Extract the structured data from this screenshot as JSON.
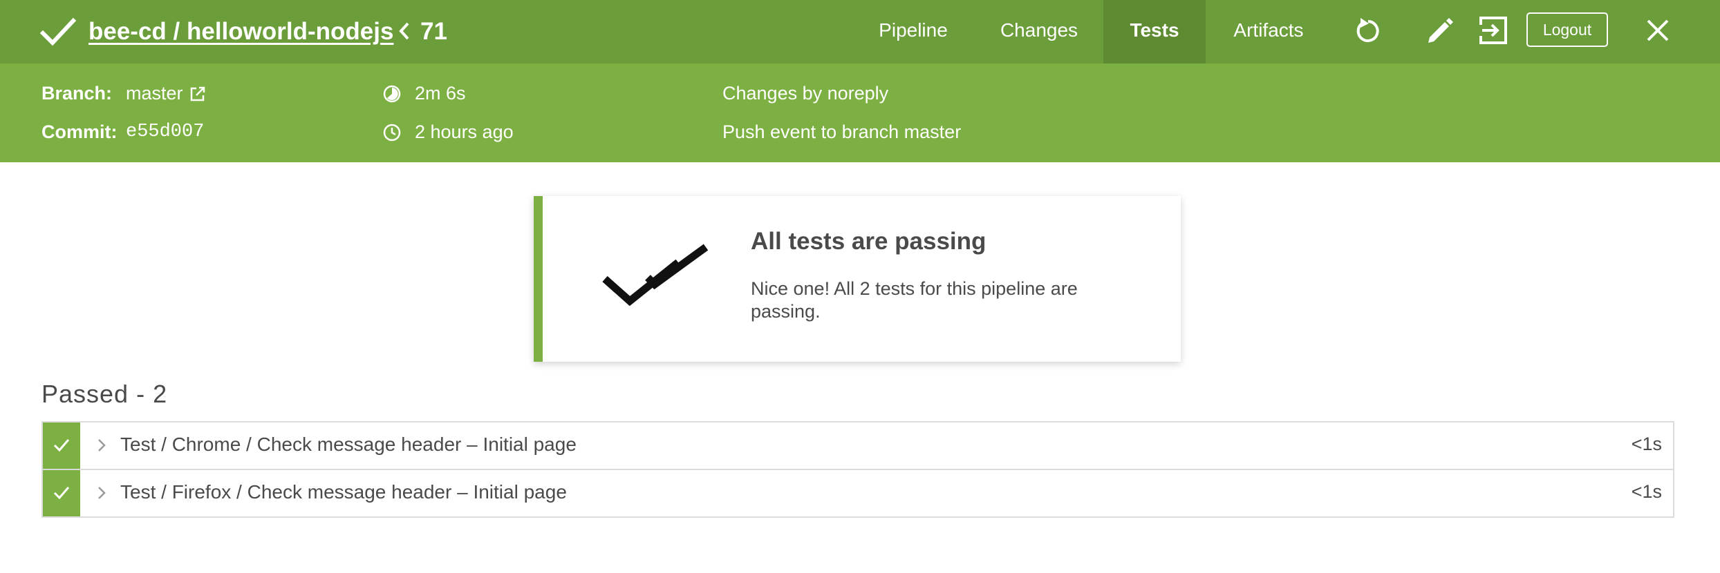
{
  "header": {
    "title": "bee-cd / helloworld-nodejs",
    "run_number": "71",
    "tabs": [
      {
        "label": "Pipeline"
      },
      {
        "label": "Changes"
      },
      {
        "label": "Tests"
      },
      {
        "label": "Artifacts"
      }
    ],
    "active_tab": "Tests",
    "logout_label": "Logout",
    "icons": [
      "check-icon",
      "chevron-left-icon",
      "replay-icon",
      "pencil-icon",
      "exit-icon",
      "close-icon"
    ]
  },
  "run_info": {
    "branch_label": "Branch:",
    "branch_value": "master",
    "commit_label": "Commit:",
    "commit_value": "e55d007",
    "duration": "2m 6s",
    "started": "2 hours ago",
    "changes_by": "Changes by noreply",
    "cause": "Push event to branch master"
  },
  "summary": {
    "title": "All tests are passing",
    "message": "Nice one! All 2 tests for this pipeline are passing.",
    "icon": "double-check-icon"
  },
  "passed_section": {
    "heading": "Passed - 2",
    "tests": [
      {
        "name": "Test / Chrome / Check message header – Initial page",
        "duration": "<1s",
        "status": "passed"
      },
      {
        "name": "Test / Firefox / Check message header – Initial page",
        "duration": "<1s",
        "status": "passed"
      }
    ]
  },
  "colors": {
    "header_bg": "#6b9e3a",
    "active_tab_bg": "#5e8b32",
    "info_bg": "#7db042",
    "success": "#7db042",
    "text": "#4a4a4a"
  }
}
